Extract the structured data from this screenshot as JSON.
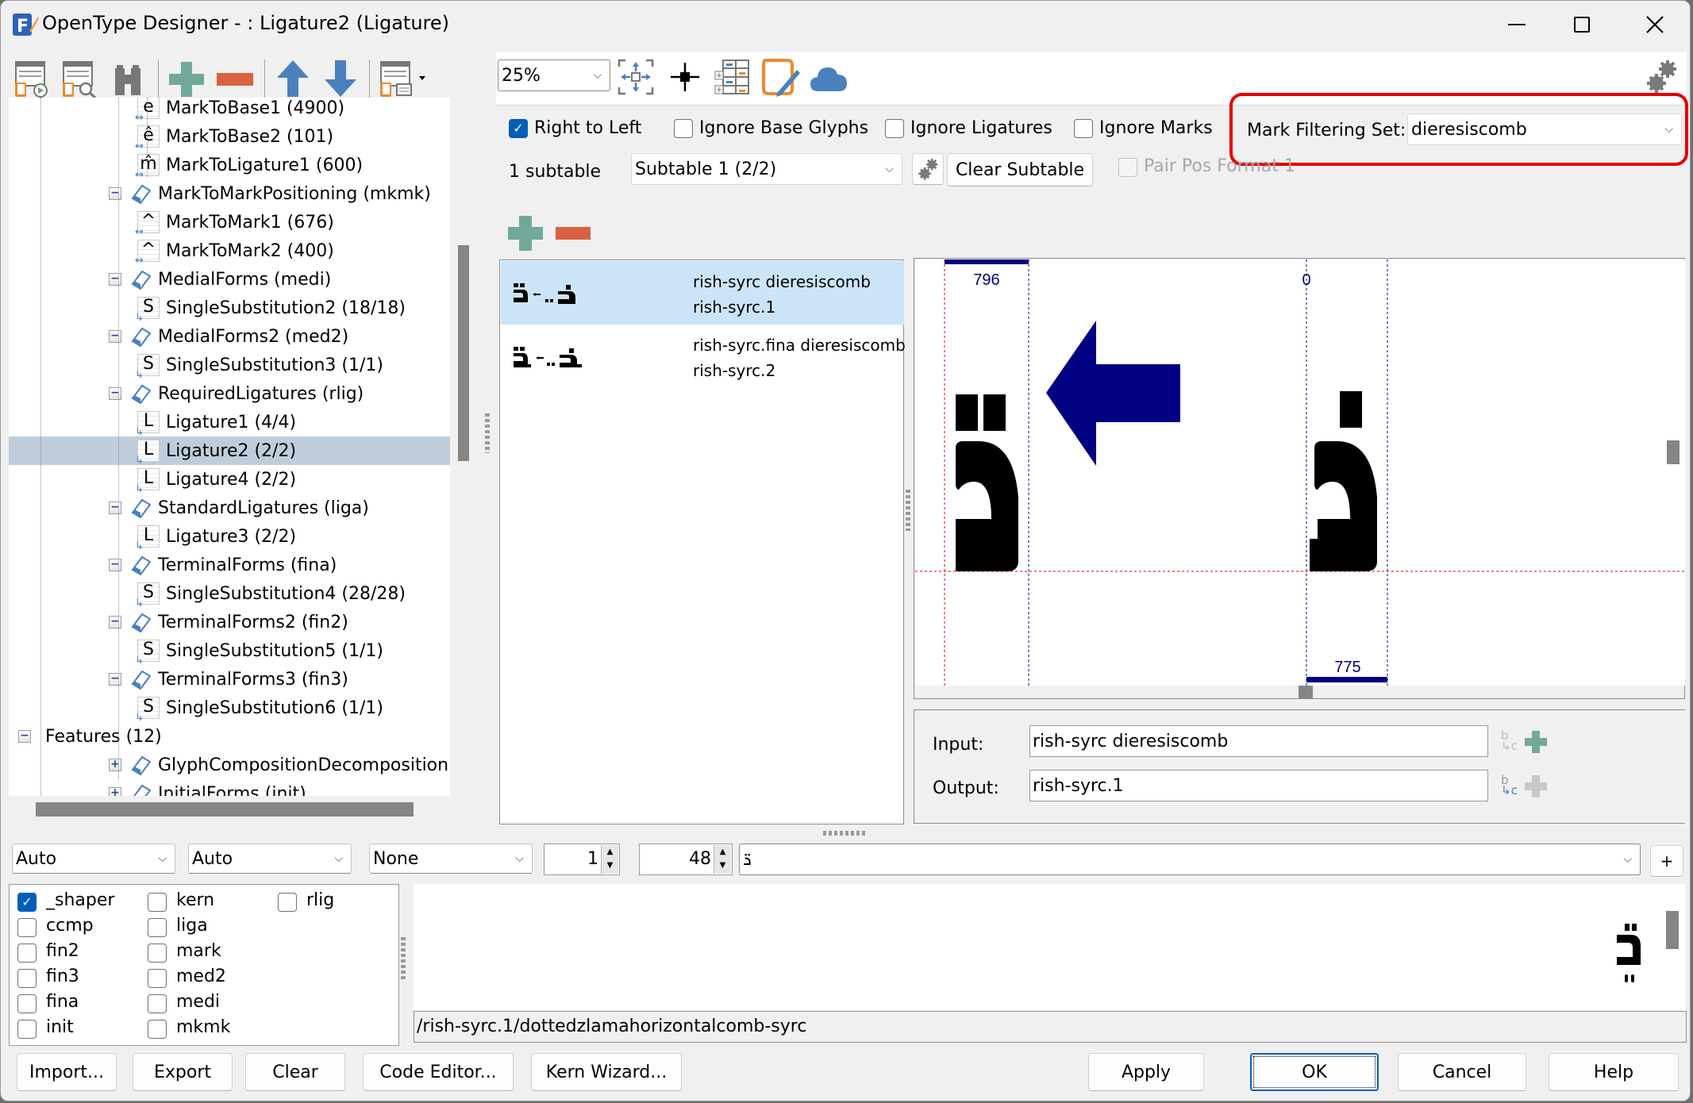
{
  "window": {
    "title": "OpenType Designer - : Ligature2 (Ligature)",
    "minimize_label": "—",
    "maximize_label": "☐",
    "close_label": "✕"
  },
  "left_toolbar": {
    "icons": [
      "import-feature-icon",
      "find-lookup-icon",
      "binoculars-icon",
      "add-icon",
      "remove-icon",
      "move-up-icon",
      "move-down-icon",
      "options-dropdown-icon"
    ]
  },
  "tree": {
    "rows": [
      {
        "level": 3,
        "icon": "e",
        "label": "MarkToBase1 (4900)"
      },
      {
        "level": 3,
        "icon": "ê",
        "label": "MarkToBase2 (101)"
      },
      {
        "level": 3,
        "icon": "m̂",
        "label": "MarkToLigature1 (600)"
      },
      {
        "level": 2,
        "icon": "feature",
        "label": "MarkToMarkPositioning (mkmk)"
      },
      {
        "level": 3,
        "icon": "^",
        "label": "MarkToMark1 (676)"
      },
      {
        "level": 3,
        "icon": "^",
        "label": "MarkToMark2 (400)"
      },
      {
        "level": 2,
        "icon": "feature",
        "label": "MedialForms (medi)"
      },
      {
        "level": 3,
        "icon": "S",
        "label": "SingleSubstitution2 (18/18)"
      },
      {
        "level": 2,
        "icon": "feature",
        "label": "MedialForms2 (med2)"
      },
      {
        "level": 3,
        "icon": "S",
        "label": "SingleSubstitution3 (1/1)"
      },
      {
        "level": 2,
        "icon": "feature",
        "label": "RequiredLigatures (rlig)"
      },
      {
        "level": 3,
        "icon": "L",
        "label": "Ligature1 (4/4)"
      },
      {
        "level": 3,
        "icon": "L",
        "label": "Ligature2 (2/2)",
        "selected": true
      },
      {
        "level": 3,
        "icon": "L",
        "label": "Ligature4 (2/2)"
      },
      {
        "level": 2,
        "icon": "feature",
        "label": "StandardLigatures (liga)"
      },
      {
        "level": 3,
        "icon": "L",
        "label": "Ligature3 (2/2)"
      },
      {
        "level": 2,
        "icon": "feature",
        "label": "TerminalForms (fina)"
      },
      {
        "level": 3,
        "icon": "S",
        "label": "SingleSubstitution4 (28/28)"
      },
      {
        "level": 2,
        "icon": "feature",
        "label": "TerminalForms2 (fin2)"
      },
      {
        "level": 3,
        "icon": "S",
        "label": "SingleSubstitution5 (1/1)"
      },
      {
        "level": 2,
        "icon": "feature",
        "label": "TerminalForms3 (fin3)"
      },
      {
        "level": 3,
        "icon": "S",
        "label": "SingleSubstitution6 (1/1)"
      },
      {
        "level": 1,
        "icon": "none",
        "label": "Features (12)"
      },
      {
        "level": 2,
        "icon": "feature-collapsed",
        "label": "GlyphCompositionDecomposition (ccmp)"
      },
      {
        "level": 2,
        "icon": "feature-collapsed",
        "label": "InitialForms (init)"
      }
    ]
  },
  "editor_toolbar": {
    "zoom": "25%",
    "icons": [
      "fit-view-icon",
      "crosshair-icon",
      "glyph-table-icon",
      "edit-script-icon",
      "cloud-icon"
    ]
  },
  "options": {
    "right_to_left": {
      "label": "Right to Left",
      "checked": true
    },
    "ignore_base_glyphs": {
      "label": "Ignore Base Glyphs",
      "checked": false
    },
    "ignore_ligatures": {
      "label": "Ignore Ligatures",
      "checked": false
    },
    "ignore_marks": {
      "label": "Ignore Marks",
      "checked": false
    },
    "mark_filtering_set_label": "Mark Filtering Set:",
    "mark_filtering_set_value": "dieresiscomb",
    "subtable_count": "1 subtable",
    "subtable_selected": "Subtable 1 (2/2)",
    "clear_subtable": "Clear Subtable",
    "pair_pos_format": {
      "label": "Pair Pos Format 1",
      "checked": false,
      "disabled": true
    }
  },
  "rules": [
    {
      "input": "rish-syrc dieresiscomb",
      "output": "rish-syrc.1",
      "selected": true
    },
    {
      "input": "rish-syrc.fina dieresiscomb",
      "output": "rish-syrc.2",
      "selected": false
    }
  ],
  "preview": {
    "left_advance": "796",
    "origin": "0",
    "right_advance": "775",
    "arrow_color": "#000080",
    "highlight_color": "#e00000"
  },
  "rule_editor": {
    "input_label": "Input:",
    "input_value": "rish-syrc dieresiscomb",
    "output_label": "Output:",
    "output_value": "rish-syrc.1"
  },
  "test_bar": {
    "script": "Auto",
    "language": "Auto",
    "direction": "None",
    "spin1": "1",
    "font_size": "48",
    "text": "ܪ̈",
    "add_label": "+"
  },
  "features": [
    {
      "tag": "_shaper",
      "checked": true
    },
    {
      "tag": "ccmp",
      "checked": false
    },
    {
      "tag": "fin2",
      "checked": false
    },
    {
      "tag": "fin3",
      "checked": false
    },
    {
      "tag": "fina",
      "checked": false
    },
    {
      "tag": "init",
      "checked": false
    },
    {
      "tag": "kern",
      "checked": false
    },
    {
      "tag": "liga",
      "checked": false
    },
    {
      "tag": "mark",
      "checked": false
    },
    {
      "tag": "med2",
      "checked": false
    },
    {
      "tag": "medi",
      "checked": false
    },
    {
      "tag": "mkmk",
      "checked": false
    },
    {
      "tag": "rlig",
      "checked": false
    }
  ],
  "glyph_path": "/rish-syrc.1/dottedzlamahorizontalcomb-syrc",
  "buttons": {
    "import": "Import...",
    "export": "Export",
    "clear": "Clear",
    "code_editor": "Code Editor...",
    "kern_wizard": "Kern Wizard...",
    "apply": "Apply",
    "ok": "OK",
    "cancel": "Cancel",
    "help": "Help"
  }
}
